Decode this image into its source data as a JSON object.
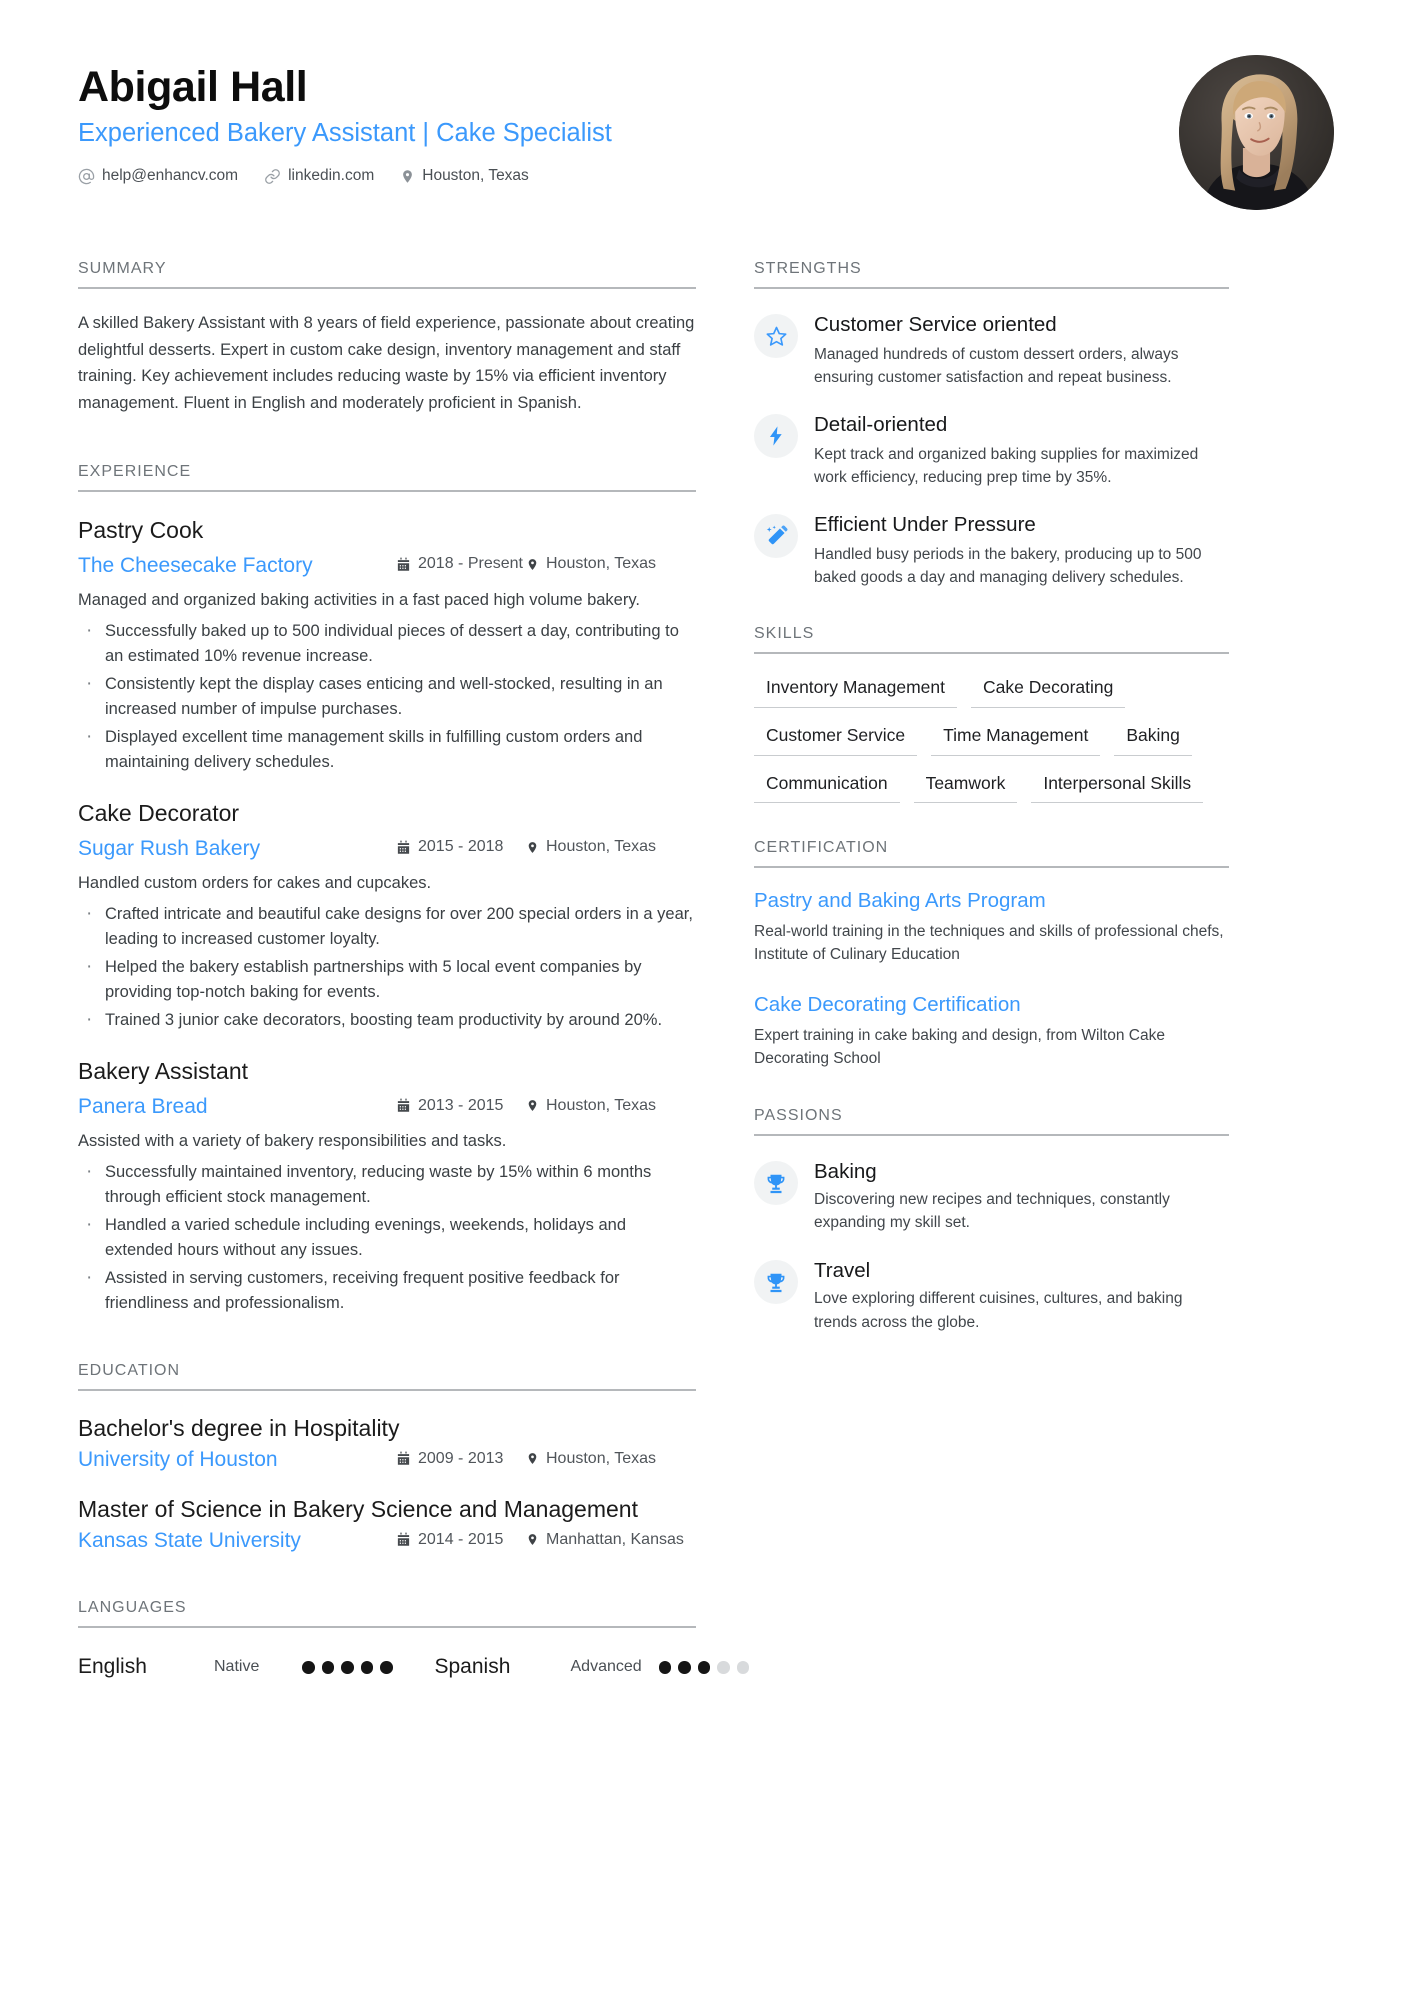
{
  "theme": {
    "accent": "#3b99fc",
    "heading_gray": "#6e7479",
    "rule": "#b5b8bb",
    "text": "#3b4044"
  },
  "header": {
    "name": "Abigail Hall",
    "headline": "Experienced Bakery Assistant | Cake Specialist",
    "contacts": [
      {
        "icon": "at-sign-icon",
        "text": "help@enhancv.com"
      },
      {
        "icon": "link-icon",
        "text": "linkedin.com"
      },
      {
        "icon": "map-pin-icon",
        "text": "Houston, Texas"
      }
    ]
  },
  "sections": {
    "summary_title": "SUMMARY",
    "experience_title": "EXPERIENCE",
    "education_title": "EDUCATION",
    "languages_title": "LANGUAGES",
    "strengths_title": "STRENGTHS",
    "skills_title": "SKILLS",
    "certification_title": "CERTIFICATION",
    "passions_title": "PASSIONS"
  },
  "summary": {
    "text": "A skilled Bakery Assistant with 8 years of field experience, passionate about creating delightful desserts. Expert in custom cake design, inventory management and staff training. Key achievement includes reducing waste by 15% via efficient inventory management. Fluent in English and moderately proficient in Spanish."
  },
  "experience": [
    {
      "title": "Pastry Cook",
      "company": "The Cheesecake Factory",
      "dates": "2018 - Present",
      "location": "Houston, Texas",
      "description": "Managed and organized baking activities in a fast paced high volume bakery.",
      "bullets": [
        "Successfully baked up to 500 individual pieces of dessert a day, contributing to an estimated 10% revenue increase.",
        "Consistently kept the display cases enticing and well-stocked, resulting in an increased number of impulse purchases.",
        "Displayed excellent time management skills in fulfilling custom orders and maintaining delivery schedules."
      ]
    },
    {
      "title": "Cake Decorator",
      "company": "Sugar Rush Bakery",
      "dates": "2015 - 2018",
      "location": "Houston, Texas",
      "description": "Handled custom orders for cakes and cupcakes.",
      "bullets": [
        "Crafted intricate and beautiful cake designs for over 200 special orders in a year, leading to increased customer loyalty.",
        "Helped the bakery establish partnerships with 5 local event companies by providing top-notch baking for events.",
        "Trained 3 junior cake decorators, boosting team productivity by around 20%."
      ]
    },
    {
      "title": "Bakery Assistant",
      "company": "Panera Bread",
      "dates": "2013 - 2015",
      "location": "Houston, Texas",
      "description": "Assisted with a variety of bakery responsibilities and tasks.",
      "bullets": [
        "Successfully maintained inventory, reducing waste by 15% within 6 months through efficient stock management.",
        "Handled a varied schedule including evenings, weekends, holidays and extended hours without any issues.",
        "Assisted in serving customers, receiving frequent positive feedback for friendliness and professionalism."
      ]
    }
  ],
  "education": [
    {
      "degree": "Bachelor's degree in Hospitality",
      "school": "University of Houston",
      "dates": "2009 - 2013",
      "location": "Houston, Texas"
    },
    {
      "degree": "Master of Science in Bakery Science and Management",
      "school": "Kansas State University",
      "dates": "2014 - 2015",
      "location": "Manhattan, Kansas"
    }
  ],
  "languages": [
    {
      "name": "English",
      "level": "Native",
      "filled": 5,
      "total": 5
    },
    {
      "name": "Spanish",
      "level": "Advanced",
      "filled": 3,
      "total": 5
    }
  ],
  "strengths": [
    {
      "icon": "star-icon",
      "name": "Customer Service oriented",
      "description": "Managed hundreds of custom dessert orders, always ensuring customer satisfaction and repeat business."
    },
    {
      "icon": "lightning-bolt-icon",
      "name": "Detail-oriented",
      "description": "Kept track and organized baking supplies for maximized work efficiency, reducing prep time by 35%."
    },
    {
      "icon": "magic-wand-icon",
      "name": "Efficient Under Pressure",
      "description": "Handled busy periods in the bakery, producing up to 500 baked goods a day and managing delivery schedules."
    }
  ],
  "skills": [
    "Inventory Management",
    "Cake Decorating",
    "Customer Service",
    "Time Management",
    "Baking",
    "Communication",
    "Teamwork",
    "Interpersonal Skills"
  ],
  "certifications": [
    {
      "title": "Pastry and Baking Arts Program",
      "description": "Real-world training in the techniques and skills of professional chefs, Institute of Culinary Education"
    },
    {
      "title": "Cake Decorating Certification",
      "description": "Expert training in cake baking and design, from Wilton Cake Decorating School"
    }
  ],
  "passions": [
    {
      "icon": "trophy-icon",
      "name": "Baking",
      "description": "Discovering new recipes and techniques, constantly expanding my skill set."
    },
    {
      "icon": "trophy-icon",
      "name": "Travel",
      "description": "Love exploring different cuisines, cultures, and baking trends across the globe."
    }
  ]
}
